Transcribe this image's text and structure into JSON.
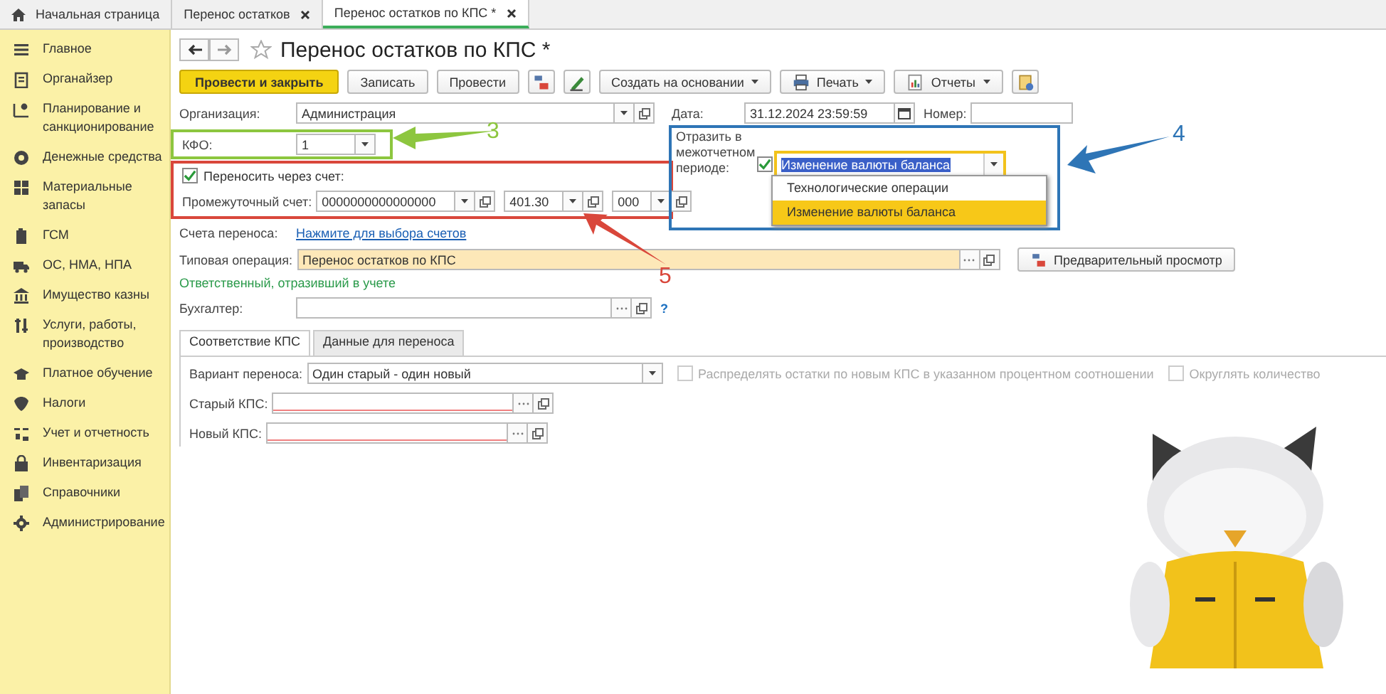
{
  "tabs": [
    {
      "label": "Начальная страница",
      "kind": "home",
      "selected": false
    },
    {
      "label": "Перенос остатков",
      "kind": "doc",
      "selected": false
    },
    {
      "label": "Перенос остатков по КПС *",
      "kind": "doc",
      "selected": true
    }
  ],
  "sidebar": {
    "items": [
      {
        "label": "Главное"
      },
      {
        "label": "Органайзер"
      },
      {
        "label": "Планирование и санкционирование"
      },
      {
        "label": "Денежные средства"
      },
      {
        "label": "Материальные запасы"
      },
      {
        "label": "ГСМ"
      },
      {
        "label": "ОС, НМА, НПА"
      },
      {
        "label": "Имущество казны"
      },
      {
        "label": "Услуги, работы, производство"
      },
      {
        "label": "Платное обучение"
      },
      {
        "label": "Налоги"
      },
      {
        "label": "Учет и отчетность"
      },
      {
        "label": "Инвентаризация"
      },
      {
        "label": "Справочники"
      },
      {
        "label": "Администрирование"
      }
    ]
  },
  "form": {
    "title": "Перенос остатков по КПС *",
    "toolbar": [
      {
        "kind": "primary",
        "label": "Провести и закрыть"
      },
      {
        "kind": "plain",
        "label": "Записать"
      },
      {
        "kind": "plain",
        "label": "Провести"
      },
      {
        "kind": "icon"
      },
      {
        "kind": "icon"
      },
      {
        "kind": "menu",
        "label": "Создать на основании"
      },
      {
        "kind": "menu",
        "label": "Печать"
      },
      {
        "kind": "menu",
        "label": "Отчеты"
      },
      {
        "kind": "icon"
      }
    ],
    "organization": {
      "label": "Организация:",
      "value": "Администрация"
    },
    "date": {
      "label": "Дата:",
      "value": "31.12.2024 23:59:59"
    },
    "number": {
      "label": "Номер:"
    },
    "kfo": {
      "label": "КФО:",
      "value": "1"
    },
    "transfer_via_account": {
      "label": "Переносить через счет:",
      "checked": true
    },
    "intermediate_account": {
      "label": "Промежуточный счет:",
      "values": [
        "0000000000000000",
        "401.30",
        "000"
      ]
    },
    "reflect": {
      "label": "Отразить в межотчетном периоде:",
      "checked": true,
      "value": "Изменение валюты баланса",
      "options": [
        {
          "label": "Технологические операции",
          "selected": false
        },
        {
          "label": "Изменение валюты баланса",
          "selected": true
        }
      ]
    },
    "accounts": {
      "label": "Счета переноса:",
      "link": "Нажмите для выбора счетов"
    },
    "operation": {
      "label": "Типовая операция:",
      "value": "Перенос остатков по КПС",
      "preview_button": "Предварительный просмотр"
    },
    "responsible_heading": "Ответственный, отразивший в учете",
    "accountant": {
      "label": "Бухгалтер:",
      "help": "?"
    },
    "inner_tabs": [
      {
        "label": "Соответствие КПС",
        "selected": true
      },
      {
        "label": "Данные для переноса",
        "selected": false
      }
    ],
    "variant": {
      "label": "Вариант переноса:",
      "value": "Один старый - один новый"
    },
    "options": [
      {
        "label": "Распределять остатки по новым КПС в указанном процентном соотношении",
        "checked": false,
        "disabled": true
      },
      {
        "label": "Округлять количество",
        "checked": false,
        "disabled": true
      }
    ],
    "kps_fields": [
      {
        "label": "Старый КПС:",
        "required": true
      },
      {
        "label": "Новый КПС:",
        "required": true
      }
    ]
  },
  "annotations": [
    {
      "label": "3",
      "color": "#8dc63f"
    },
    {
      "label": "4",
      "color": "#2e75b6"
    },
    {
      "label": "5",
      "color": "#d9473b"
    }
  ]
}
